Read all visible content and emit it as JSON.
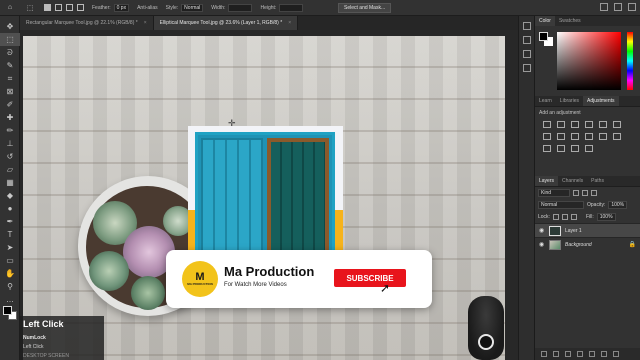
{
  "options_bar": {
    "feather_label": "Feather:",
    "feather_value": "0 px",
    "antialias_label": "Anti-alias",
    "style_label": "Style:",
    "style_value": "Normal",
    "width_label": "Width:",
    "height_label": "Height:",
    "select_mask_label": "Select and Mask..."
  },
  "tabs": [
    {
      "label": "Rectangular Marquee Tool.jpg @ 22.1% (RGB/8) *",
      "close": "×"
    },
    {
      "label": "Elliptical Marquee Tool.jpg @ 23.6% (Layer 1, RGB/8) *",
      "close": "×"
    }
  ],
  "tools": [
    {
      "icon": "move-icon",
      "glyph": "✥"
    },
    {
      "icon": "marquee-icon",
      "glyph": "⬚"
    },
    {
      "icon": "lasso-icon",
      "glyph": "ᘐ"
    },
    {
      "icon": "quick-select-icon",
      "glyph": "✎"
    },
    {
      "icon": "crop-icon",
      "glyph": "⌗"
    },
    {
      "icon": "frame-icon",
      "glyph": "⊠"
    },
    {
      "icon": "eyedropper-icon",
      "glyph": "✐"
    },
    {
      "icon": "healing-icon",
      "glyph": "✚"
    },
    {
      "icon": "brush-icon",
      "glyph": "✏"
    },
    {
      "icon": "stamp-icon",
      "glyph": "⊥"
    },
    {
      "icon": "history-brush-icon",
      "glyph": "↺"
    },
    {
      "icon": "eraser-icon",
      "glyph": "▱"
    },
    {
      "icon": "gradient-icon",
      "glyph": "▦"
    },
    {
      "icon": "blur-icon",
      "glyph": "◆"
    },
    {
      "icon": "dodge-icon",
      "glyph": "●"
    },
    {
      "icon": "pen-icon",
      "glyph": "✒"
    },
    {
      "icon": "type-icon",
      "glyph": "T"
    },
    {
      "icon": "path-select-icon",
      "glyph": "➤"
    },
    {
      "icon": "rectangle-icon",
      "glyph": "▭"
    },
    {
      "icon": "hand-icon",
      "glyph": "✋"
    },
    {
      "icon": "zoom-icon",
      "glyph": "⚲"
    },
    {
      "icon": "more-icon",
      "glyph": "…"
    }
  ],
  "panels": {
    "color_tabs": [
      "Color",
      "Swatches"
    ],
    "adjust_tabs": [
      "Learn",
      "Libraries",
      "Adjustments"
    ],
    "adjust_label": "Add an adjustment",
    "layers_tabs": [
      "Layers",
      "Channels",
      "Paths"
    ],
    "kind_value": "Kind",
    "blend_value": "Normal",
    "opacity_label": "Opacity:",
    "opacity_value": "100%",
    "lock_label": "Lock:",
    "fill_label": "Fill:",
    "fill_value": "100%",
    "layers": [
      {
        "name": "Layer 1",
        "selected": true
      },
      {
        "name": "Background",
        "selected": false
      }
    ]
  },
  "overlay_card": {
    "logo_mark": "M",
    "logo_text": "MA PRODUCTION",
    "title": "Ma Production",
    "subtitle": "For Watch More Videos",
    "subscribe_label": "SUBSCRIBE"
  },
  "key_overlay": {
    "title": "Left Click",
    "line1": "NumLock",
    "line2": "Left Click",
    "line3": "DESKTOP SCREEN"
  },
  "colors": {
    "accent_red": "#e8141c",
    "logo_yellow": "#f2c31b",
    "window_blue": "#1f93b5",
    "window_yellow": "#f6b31b"
  }
}
